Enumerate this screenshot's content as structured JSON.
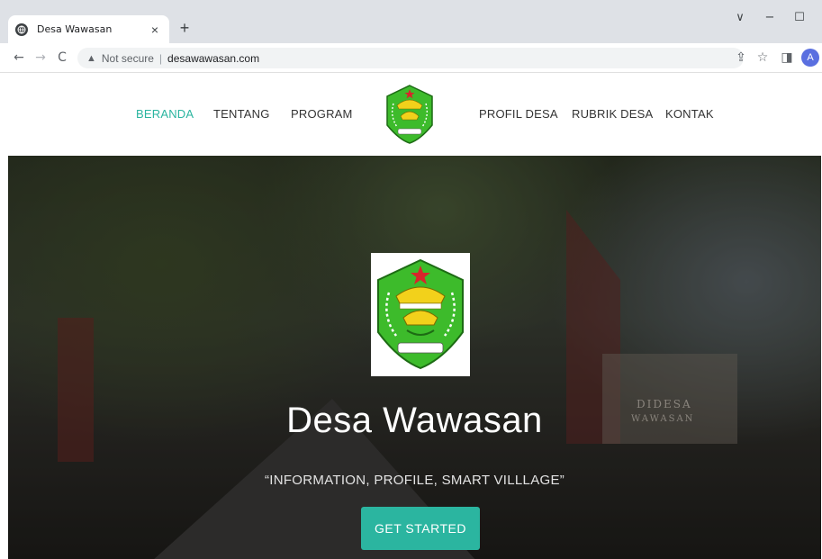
{
  "browser": {
    "tab_title": "Desa Wawasan",
    "tab_close": "×",
    "new_tab": "+",
    "win_menu": "∨",
    "win_minimize": "−",
    "win_maximize": "☐",
    "nav_back": "←",
    "nav_forward": "→",
    "nav_reload": "C",
    "security_warning": "Not secure",
    "separator": "|",
    "url": "desawawasan.com",
    "share_icon_glyph": "⇪",
    "star_icon_glyph": "☆",
    "sidepanel_icon_glyph": "◨",
    "profile_initial": "A"
  },
  "nav": {
    "items": [
      {
        "label": "BERANDA",
        "active": true
      },
      {
        "label": "TENTANG",
        "active": false
      },
      {
        "label": "PROGRAM",
        "active": false
      },
      {
        "label": "PROFIL DESA",
        "active": false
      },
      {
        "label": "RUBRIK DESA",
        "active": false
      },
      {
        "label": "KONTAK",
        "active": false
      }
    ]
  },
  "hero": {
    "title": "Desa Wawasan",
    "tagline": "“INFORMATION, PROFILE, SMART VILLLAGE”",
    "cta": "GET STARTED",
    "sign_line1": "DIDESA",
    "sign_line2": "WAWASAN"
  },
  "colors": {
    "accent": "#2bb5a0",
    "chrome_bg": "#dee1e6",
    "logo_green": "#3dbb2b",
    "logo_yellow": "#f2d11b",
    "logo_red": "#d9242b"
  }
}
